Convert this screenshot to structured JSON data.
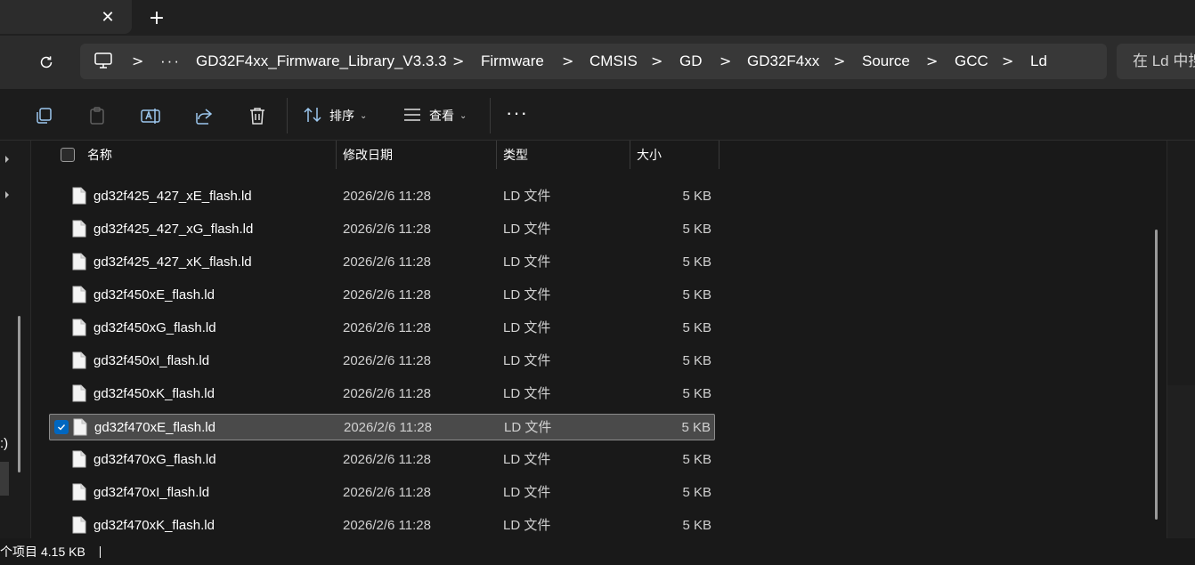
{
  "tabs": {
    "close_symbol": "✕",
    "new_tab_symbol": "+"
  },
  "address": {
    "ellipsis": "···",
    "separator": ">",
    "segments": [
      "GD32F4xx_Firmware_Library_V3.3.3",
      "Firmware",
      "CMSIS",
      "GD",
      "GD32F4xx",
      "Source",
      "GCC",
      "Ld"
    ],
    "search_placeholder": "在 Ld 中搜"
  },
  "toolbar": {
    "sort_label": "排序",
    "view_label": "查看",
    "more_label": "···",
    "caret": "⌄",
    "icons": [
      "copy-icon",
      "paste-icon",
      "rename-icon",
      "share-icon",
      "delete-icon",
      "sort-icon",
      "view-icon",
      "more-icon"
    ]
  },
  "columns": {
    "name": "名称",
    "modified": "修改日期",
    "type": "类型",
    "size": "大小",
    "sort_indicator": "^"
  },
  "files": [
    {
      "name": "gd32f425_427_xE_flash.ld",
      "modified": "2026/2/6 11:28",
      "type": "LD 文件",
      "size": "5 KB",
      "selected": false
    },
    {
      "name": "gd32f425_427_xG_flash.ld",
      "modified": "2026/2/6 11:28",
      "type": "LD 文件",
      "size": "5 KB",
      "selected": false
    },
    {
      "name": "gd32f425_427_xK_flash.ld",
      "modified": "2026/2/6 11:28",
      "type": "LD 文件",
      "size": "5 KB",
      "selected": false
    },
    {
      "name": "gd32f450xE_flash.ld",
      "modified": "2026/2/6 11:28",
      "type": "LD 文件",
      "size": "5 KB",
      "selected": false
    },
    {
      "name": "gd32f450xG_flash.ld",
      "modified": "2026/2/6 11:28",
      "type": "LD 文件",
      "size": "5 KB",
      "selected": false
    },
    {
      "name": "gd32f450xI_flash.ld",
      "modified": "2026/2/6 11:28",
      "type": "LD 文件",
      "size": "5 KB",
      "selected": false
    },
    {
      "name": "gd32f450xK_flash.ld",
      "modified": "2026/2/6 11:28",
      "type": "LD 文件",
      "size": "5 KB",
      "selected": false
    },
    {
      "name": "gd32f470xE_flash.ld",
      "modified": "2026/2/6 11:28",
      "type": "LD 文件",
      "size": "5 KB",
      "selected": true
    },
    {
      "name": "gd32f470xG_flash.ld",
      "modified": "2026/2/6 11:28",
      "type": "LD 文件",
      "size": "5 KB",
      "selected": false
    },
    {
      "name": "gd32f470xI_flash.ld",
      "modified": "2026/2/6 11:28",
      "type": "LD 文件",
      "size": "5 KB",
      "selected": false
    },
    {
      "name": "gd32f470xK_flash.ld",
      "modified": "2026/2/6 11:28",
      "type": "LD 文件",
      "size": "5 KB",
      "selected": false
    }
  ],
  "nav": {
    "partial_label": ":)"
  },
  "status": {
    "items_text": "个项目",
    "selected_size": "4.15 KB"
  },
  "colors": {
    "accent": "#0067c0",
    "selection_bg": "#4a4a4a",
    "toolbar_icon": "#9cc7ee"
  }
}
